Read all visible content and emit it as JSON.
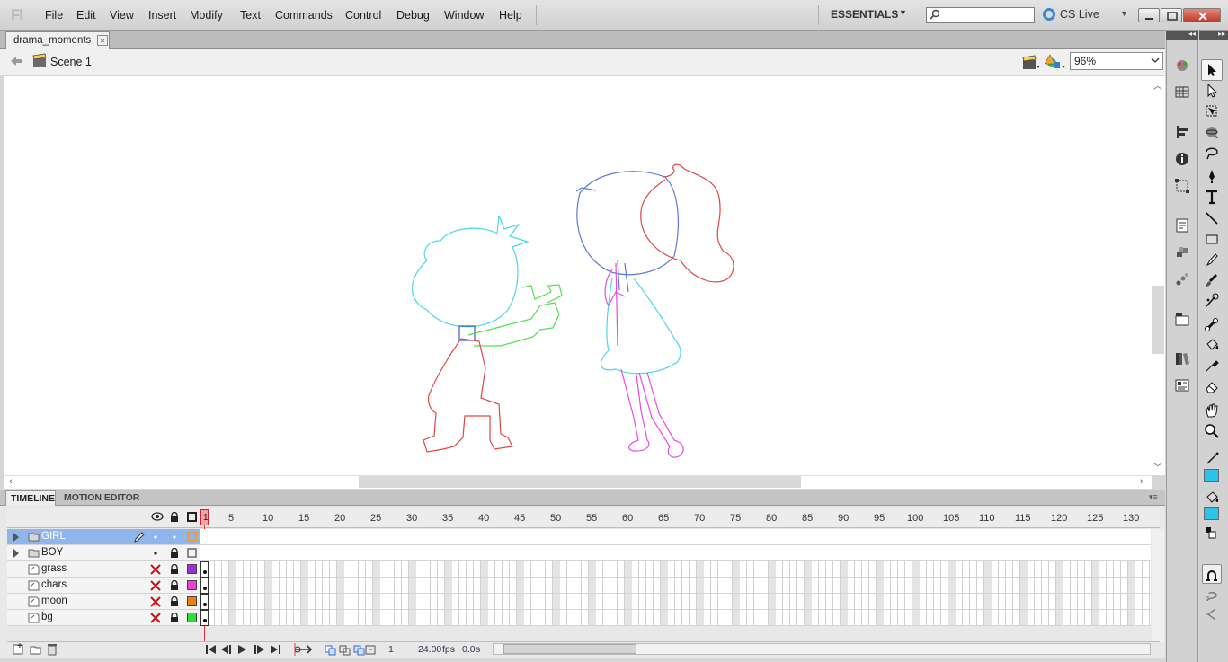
{
  "app": {
    "logo": "Fl"
  },
  "menu": [
    "File",
    "Edit",
    "View",
    "Insert",
    "Modify",
    "Text",
    "Commands",
    "Control",
    "Debug",
    "Window",
    "Help"
  ],
  "workspace": {
    "label": "ESSENTIALS"
  },
  "search": {
    "placeholder": "",
    "value": ""
  },
  "cslive": {
    "label": "CS Live"
  },
  "document": {
    "tab_label": "drama_moments",
    "close_glyph": "×"
  },
  "editbar": {
    "scene_label": "Scene 1",
    "zoom": "96%"
  },
  "panel_tabs": {
    "timeline": "TIMELINE",
    "motion_editor": "MOTION EDITOR"
  },
  "timeline": {
    "current_frame": "1",
    "ruler": [
      "5",
      "10",
      "15",
      "20",
      "25",
      "30",
      "35",
      "40",
      "45",
      "50",
      "55",
      "60",
      "65",
      "70",
      "75",
      "80",
      "85",
      "90",
      "95",
      "100",
      "105",
      "110",
      "115",
      "120",
      "125",
      "130"
    ],
    "layers": [
      {
        "name": "GIRL",
        "type": "folder",
        "selected": true,
        "visible": true,
        "locked": false,
        "outline_color": "#f59a3a"
      },
      {
        "name": "BOY",
        "type": "folder",
        "selected": false,
        "visible": true,
        "locked": true,
        "outline_color": "#888888"
      },
      {
        "name": "grass",
        "type": "layer",
        "selected": false,
        "visible": false,
        "locked": true,
        "outline_color": "#9b30d9"
      },
      {
        "name": "chars",
        "type": "layer",
        "selected": false,
        "visible": false,
        "locked": true,
        "outline_color": "#f040d8"
      },
      {
        "name": "moon",
        "type": "layer",
        "selected": false,
        "visible": false,
        "locked": true,
        "outline_color": "#f08010"
      },
      {
        "name": "bg",
        "type": "layer",
        "selected": false,
        "visible": false,
        "locked": true,
        "outline_color": "#30e030"
      }
    ],
    "footer": {
      "frame": "1",
      "fps": "24.00",
      "fps_unit": "fps",
      "time": "0.0",
      "time_unit": "s"
    }
  },
  "colors": {
    "stroke": "#29c4ea",
    "fill": "#29c4ea",
    "selection": "#8fb6ec",
    "playhead": "#e33333"
  },
  "icons": {
    "panels": [
      "color-icon",
      "swatches-icon",
      "align-icon",
      "info-icon",
      "transform-icon",
      "actions-icon",
      "components-icon",
      "motion-presets-icon",
      "project-icon",
      "library-icon",
      "properties-icon"
    ],
    "tools": [
      "selection-tool-icon",
      "subselection-tool-icon",
      "free-transform-tool-icon",
      "3d-rotation-tool-icon",
      "lasso-tool-icon",
      "pen-tool-icon",
      "text-tool-icon",
      "line-tool-icon",
      "rectangle-tool-icon",
      "pencil-tool-icon",
      "brush-tool-icon",
      "deco-tool-icon",
      "bone-tool-icon",
      "paint-bucket-tool-icon",
      "eyedropper-tool-icon",
      "eraser-tool-icon",
      "hand-tool-icon",
      "zoom-tool-icon",
      "stroke-color-icon",
      "fill-color-icon",
      "snap-to-objects-icon",
      "smooth-icon",
      "straighten-icon"
    ]
  }
}
